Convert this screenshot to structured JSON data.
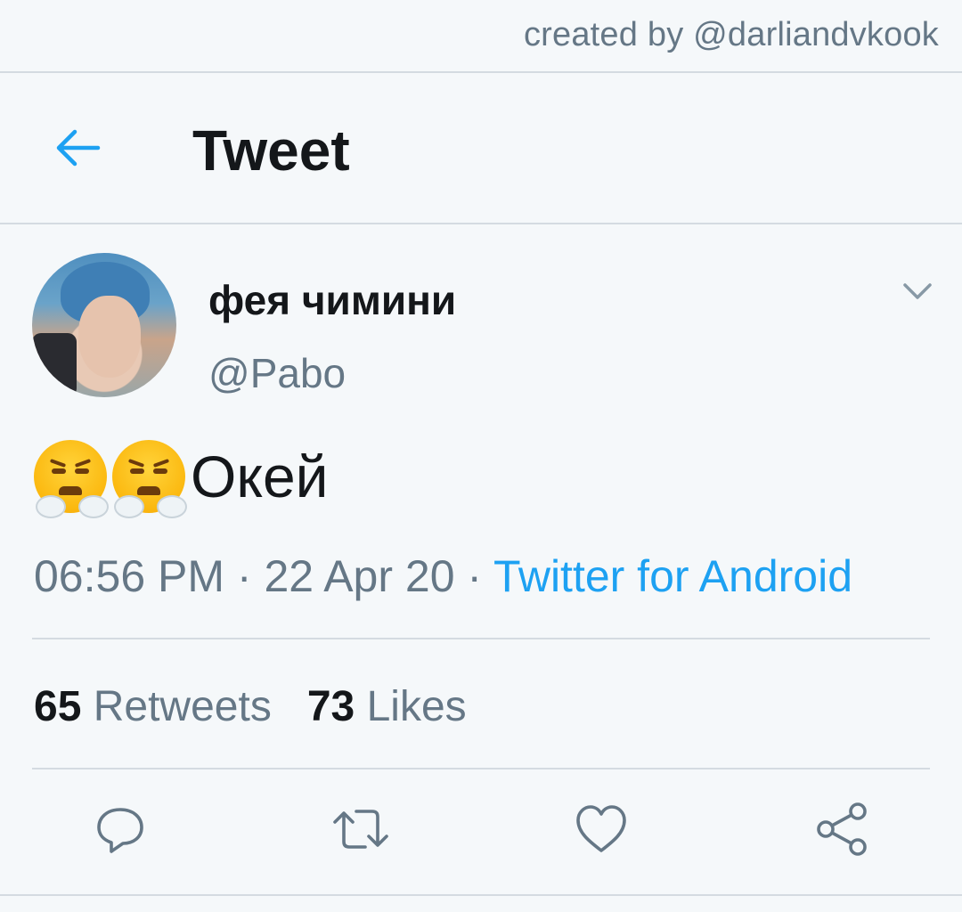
{
  "watermark": "created by @darliandvkook",
  "header": {
    "title": "Tweet",
    "back_icon": "back-arrow-icon"
  },
  "author": {
    "name": "фея чимини",
    "handle": "@Pabo"
  },
  "tweet": {
    "emojis": [
      "face-with-steam-from-nose",
      "face-with-steam-from-nose"
    ],
    "text": "Окей"
  },
  "meta": {
    "time": "06:56 PM",
    "sep1": " · ",
    "date": "22 Apr 20",
    "sep2": " · ",
    "source": "Twitter for Android"
  },
  "stats": {
    "retweets_count": "65",
    "retweets_label": "Retweets",
    "likes_count": "73",
    "likes_label": "Likes"
  },
  "actions": [
    "reply-icon",
    "retweet-icon",
    "like-icon",
    "share-icon"
  ],
  "colors": {
    "accent": "#1da1f2",
    "muted": "#657786",
    "divider": "#d4dbe1",
    "background": "#f5f8fa"
  }
}
